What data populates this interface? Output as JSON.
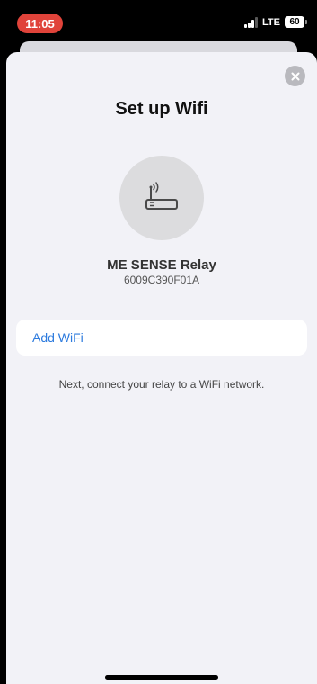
{
  "status_bar": {
    "time": "11:05",
    "network": "LTE",
    "battery": "60"
  },
  "sheet": {
    "title": "Set up Wifi",
    "device": {
      "name": "ME SENSE Relay",
      "serial": "6009C390F01A",
      "icon": "router-icon"
    },
    "add_wifi_label": "Add WiFi",
    "hint": "Next, connect your relay to a WiFi network."
  },
  "colors": {
    "accent": "#2d7bde",
    "time_pill": "#e0433a",
    "sheet_background": "#f2f2f7"
  }
}
